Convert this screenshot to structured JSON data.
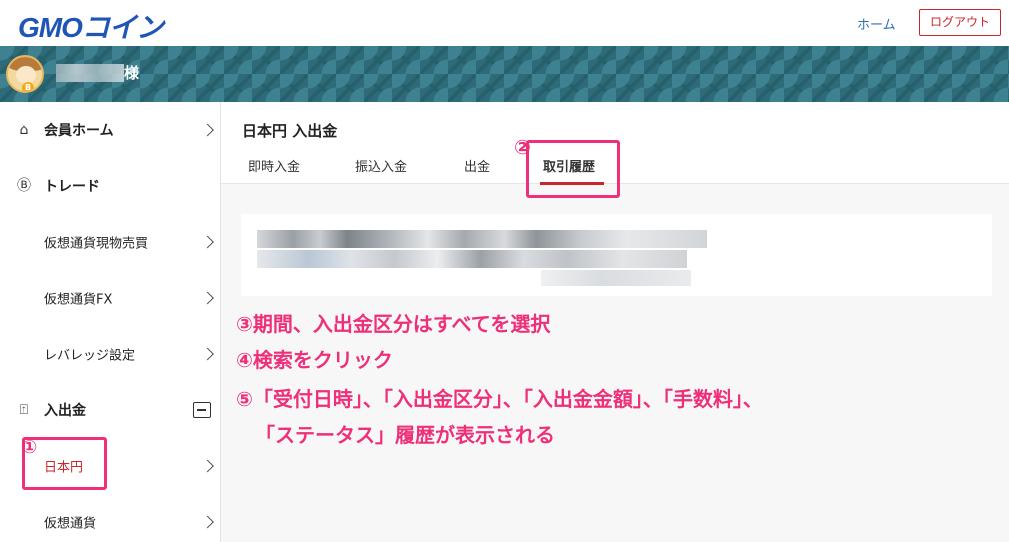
{
  "header": {
    "logo_text": "GMOコイン",
    "home_link": "ホーム",
    "logout_label": "ログアウト"
  },
  "banner": {
    "honorific": "様"
  },
  "sidebar": {
    "items": [
      {
        "label": "会員ホーム"
      },
      {
        "label": "トレード"
      },
      {
        "label": "仮想通貨現物売買"
      },
      {
        "label": "仮想通貨FX"
      },
      {
        "label": "レバレッジ設定"
      },
      {
        "label": "入出金"
      },
      {
        "label": "日本円"
      },
      {
        "label": "仮想通貨"
      }
    ],
    "annotation_number": "①"
  },
  "main": {
    "title": "日本円 入出金",
    "tabs": [
      {
        "label": "即時入金"
      },
      {
        "label": "振込入金"
      },
      {
        "label": "出金"
      },
      {
        "label": "取引履歴"
      }
    ],
    "annotation_number": "②",
    "instructions": [
      "③期間、入出金区分はすべてを選択",
      "④検索をクリック",
      "⑤「受付日時」、「入出金区分」、「入出金金額」、「手数料」、",
      "「ステータス」履歴が表示される"
    ]
  },
  "colors": {
    "brand_blue": "#1f56b6",
    "accent_red": "#c9252c",
    "annotation_pink": "#ee2f7a",
    "banner_teal": "#2f6a78"
  },
  "icons": {
    "home": "home-icon",
    "trade": "bitcoin-icon",
    "deposit": "deposit-icon"
  }
}
